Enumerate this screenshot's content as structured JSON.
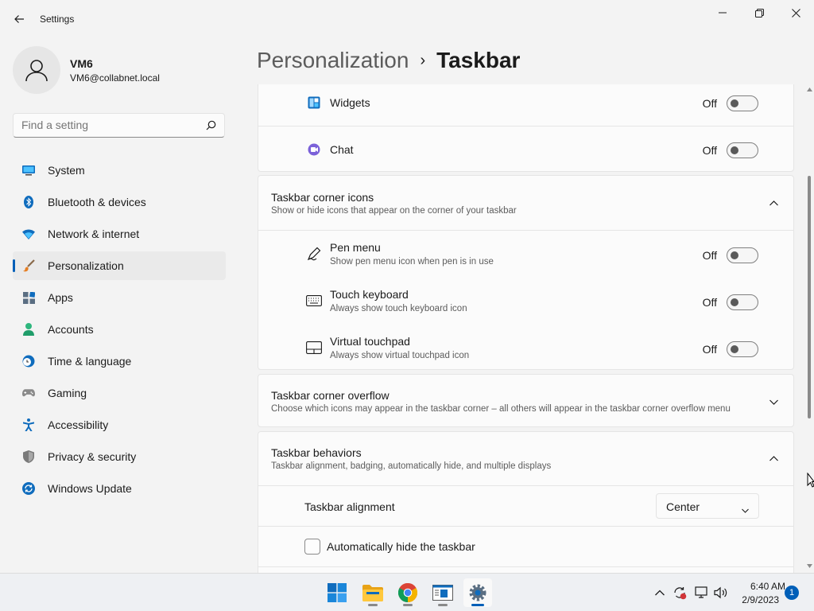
{
  "window": {
    "title": "Settings"
  },
  "user": {
    "name": "VM6",
    "email": "VM6@collabnet.local"
  },
  "search": {
    "placeholder": "Find a setting"
  },
  "sidebar": {
    "items": [
      {
        "label": "System",
        "icon": "system-icon"
      },
      {
        "label": "Bluetooth & devices",
        "icon": "bluetooth-icon"
      },
      {
        "label": "Network & internet",
        "icon": "wifi-icon"
      },
      {
        "label": "Personalization",
        "icon": "brush-icon",
        "active": true
      },
      {
        "label": "Apps",
        "icon": "apps-icon"
      },
      {
        "label": "Accounts",
        "icon": "accounts-icon"
      },
      {
        "label": "Time & language",
        "icon": "clock-globe-icon"
      },
      {
        "label": "Gaming",
        "icon": "gamepad-icon"
      },
      {
        "label": "Accessibility",
        "icon": "accessibility-icon"
      },
      {
        "label": "Privacy & security",
        "icon": "shield-icon"
      },
      {
        "label": "Windows Update",
        "icon": "update-icon"
      }
    ]
  },
  "breadcrumb": {
    "parent": "Personalization",
    "separator": "›",
    "current": "Taskbar"
  },
  "taskbar_items": {
    "widgets": {
      "label": "Widgets",
      "state": "Off"
    },
    "chat": {
      "label": "Chat",
      "state": "Off"
    }
  },
  "corner_icons": {
    "title": "Taskbar corner icons",
    "subtitle": "Show or hide icons that appear on the corner of your taskbar",
    "items": [
      {
        "label": "Pen menu",
        "sub": "Show pen menu icon when pen is in use",
        "state": "Off"
      },
      {
        "label": "Touch keyboard",
        "sub": "Always show touch keyboard icon",
        "state": "Off"
      },
      {
        "label": "Virtual touchpad",
        "sub": "Always show virtual touchpad icon",
        "state": "Off"
      }
    ]
  },
  "corner_overflow": {
    "title": "Taskbar corner overflow",
    "subtitle": "Choose which icons may appear in the taskbar corner – all others will appear in the taskbar corner overflow menu"
  },
  "behaviors": {
    "title": "Taskbar behaviors",
    "subtitle": "Taskbar alignment, badging, automatically hide, and multiple displays",
    "alignment_label": "Taskbar alignment",
    "alignment_value": "Center",
    "autohide_label": "Automatically hide the taskbar"
  },
  "clock": {
    "time": "6:40 AM",
    "date": "2/9/2023"
  },
  "notifications": {
    "count": "1"
  },
  "colors": {
    "accent": "#005fb8",
    "background": "#f3f3f3",
    "card": "#fbfbfb"
  }
}
